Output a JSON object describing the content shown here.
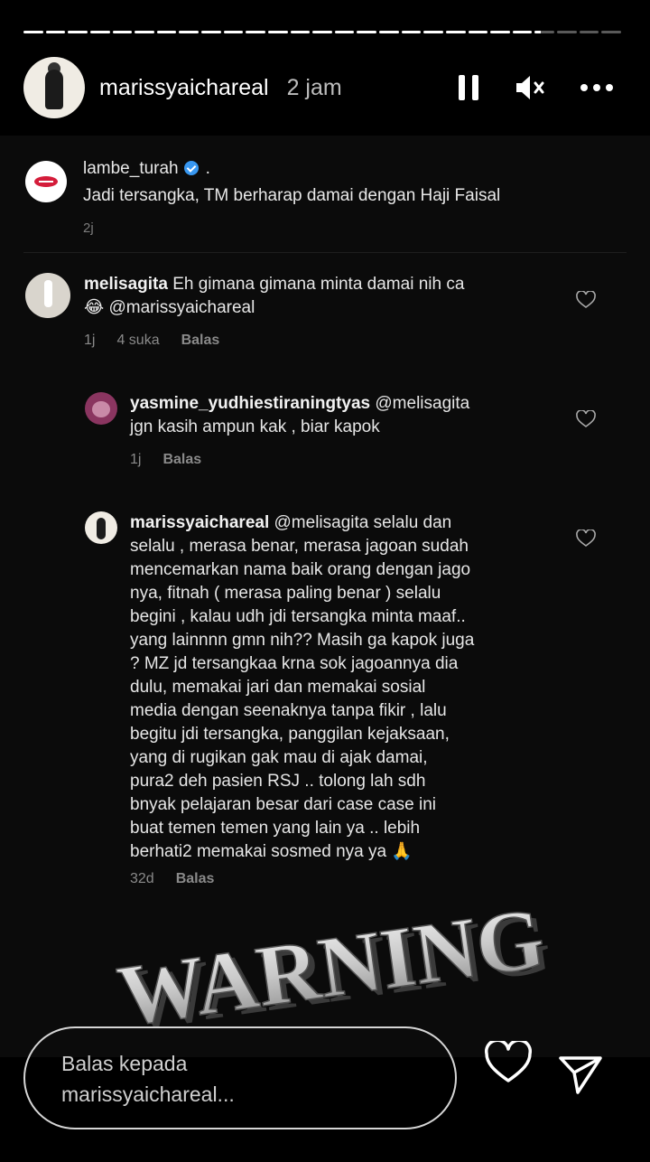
{
  "story": {
    "progress": [
      1,
      1,
      1,
      1,
      1,
      1,
      1,
      1,
      1,
      1,
      1,
      1,
      1,
      1,
      1,
      1,
      1,
      1,
      1,
      1,
      1,
      1,
      1,
      0.3,
      0,
      0,
      0
    ],
    "username": "marissyaichareal",
    "time": "2 jam",
    "icons": {
      "pause": "pause-icon",
      "mute": "mute-icon",
      "more": "more-icon"
    }
  },
  "post": {
    "account": "lambe_turah",
    "dot": ".",
    "caption": "Jadi tersangka, TM berharap damai dengan Haji Faisal",
    "time": "2j"
  },
  "comments": [
    {
      "user": "melisagita",
      "text": " Eh gimana gimana minta damai nih ca\n😂 @marissyaichareal",
      "time": "1j",
      "likes": "4 suka",
      "reply": "Balas"
    },
    {
      "user": "yasmine_yudhiestiraningtyas",
      "text": " @melisagita\njgn kasih ampun kak , biar kapok",
      "time": "1j",
      "reply": "Balas"
    },
    {
      "user": "marissyaichareal",
      "text": " @melisagita selalu dan\nselalu , merasa benar, merasa jagoan sudah\nmencemarkan nama baik orang dengan jago\nnya, fitnah ( merasa paling benar ) selalu\nbegini , kalau udh jdi tersangka minta maaf..\nyang lainnnn gmn nih?? Masih ga kapok juga\n?  MZ jd tersangkaa krna sok jagoannya dia\ndulu, memakai jari dan memakai sosial\nmedia dengan seenaknya tanpa fikir , lalu\nbegitu jdi tersangka, panggilan kejaksaan,\nyang di rugikan gak mau di ajak damai,\npura2 deh  pasien RSJ .. tolong lah sdh\nbnyak pelajaran besar dari case case ini\nbuat temen temen yang lain ya .. lebih\nberhati2 memakai sosmed nya ya 🙏",
      "time": "32d",
      "reply": "Balas"
    }
  ],
  "overlay": {
    "text": "WARNING"
  },
  "reply_bar": {
    "placeholder": "Balas kepada\nmarissyaichareal...",
    "icons": {
      "like": "heart-icon",
      "send": "send-icon"
    }
  }
}
